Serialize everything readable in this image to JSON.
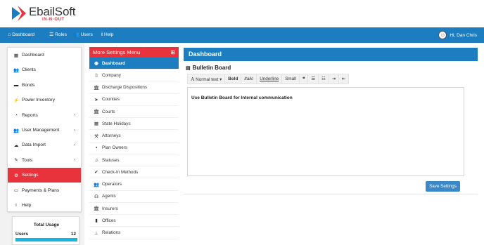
{
  "logo": {
    "name": "EbailSoft",
    "sub": "IN-N-OUT"
  },
  "topnav": {
    "items": [
      {
        "icon": "home-icon",
        "glyph": "⌂",
        "label": "Dashboard"
      },
      {
        "icon": "list-icon",
        "glyph": "☰",
        "label": "Roles"
      },
      {
        "icon": "users-icon",
        "glyph": "👥",
        "label": "Users"
      },
      {
        "icon": "info-icon",
        "glyph": "i",
        "label": "Help"
      }
    ],
    "user_greeting": "Hi, Dan Chris"
  },
  "sidebar": {
    "items": [
      {
        "label": "Dashboard",
        "glyph": "▦",
        "chevron": ""
      },
      {
        "label": "Clients",
        "glyph": "👥",
        "chevron": ""
      },
      {
        "label": "Bonds",
        "glyph": "▬",
        "chevron": ""
      },
      {
        "label": "Power Inventory",
        "glyph": "⚡",
        "chevron": ""
      },
      {
        "label": "Reports",
        "glyph": "◔",
        "chevron": "‹"
      },
      {
        "label": "User Management",
        "glyph": "👥",
        "chevron": "‹"
      },
      {
        "label": "Data Import",
        "glyph": "☁",
        "chevron": "‹"
      },
      {
        "label": "Tools",
        "glyph": "✎",
        "chevron": "‹"
      },
      {
        "label": "Settings",
        "glyph": "⚙",
        "chevron": ""
      },
      {
        "label": "Payments & Plans",
        "glyph": "▭",
        "chevron": ""
      },
      {
        "label": "Help",
        "glyph": "i",
        "chevron": ""
      }
    ],
    "active_index": 8
  },
  "usage": {
    "title": "Total Usage",
    "label": "Users",
    "count": "12",
    "fill_fraction": 1.0,
    "fill_color": "#17b4e0"
  },
  "settings_menu": {
    "title": "More Settings Menu",
    "plus": "⊞",
    "items": [
      {
        "label": "Dashboard",
        "glyph": "◉"
      },
      {
        "label": "Company",
        "glyph": "▯"
      },
      {
        "label": "Discharge Dispositions",
        "glyph": "🏛"
      },
      {
        "label": "Counties",
        "glyph": "➤"
      },
      {
        "label": "Courts",
        "glyph": "🏛"
      },
      {
        "label": "State Holidays",
        "glyph": "▦"
      },
      {
        "label": "Attorneys",
        "glyph": "⚒"
      },
      {
        "label": "Plan Owners",
        "glyph": "▪"
      },
      {
        "label": "Statuses",
        "glyph": "♫"
      },
      {
        "label": "Check-In Methods",
        "glyph": "✔"
      },
      {
        "label": "Operators",
        "glyph": "👥"
      },
      {
        "label": "Agents",
        "glyph": "☊"
      },
      {
        "label": "Insurers",
        "glyph": "🏛"
      },
      {
        "label": "Offices",
        "glyph": "▮"
      },
      {
        "label": "Relations",
        "glyph": "⊥"
      }
    ],
    "active_index": 0
  },
  "main": {
    "title": "Dashboard",
    "bulletin_title": "Bulletin Board",
    "toolbar": {
      "normal_text": "Normal text",
      "bold": "Bold",
      "italic": "Italic",
      "underline": "Underline",
      "small": "Small",
      "quote": "❝",
      "list_ul": "☰",
      "list_ol": "☷",
      "indent": "⇥",
      "outdent": "⇤"
    },
    "editor_text": "Use Bulletin Board for Internal communication",
    "save_label": "Save Settings"
  },
  "colors": {
    "brand_blue": "#1c7ec0",
    "brand_red": "#e8323c",
    "save_blue": "#3a88c8"
  }
}
